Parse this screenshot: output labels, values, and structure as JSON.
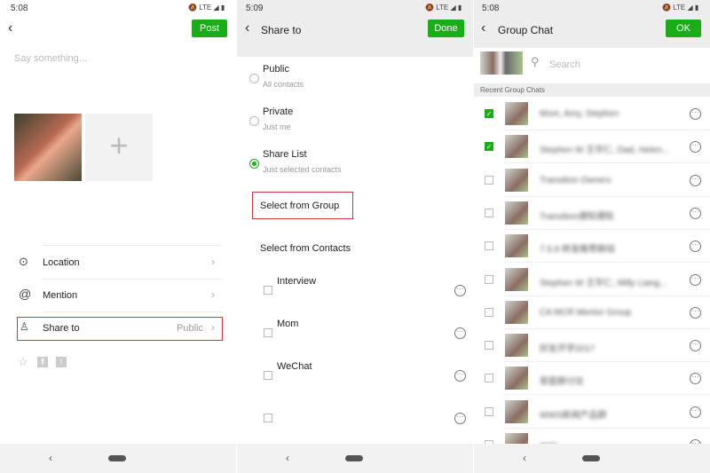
{
  "colors": {
    "accent": "#1aad19",
    "highlight": "#d0363e"
  },
  "panel1": {
    "time": "5:08",
    "network": "LTE",
    "post_label": "Post",
    "placeholder": "Say something...",
    "add_icon": "plus-icon",
    "menu": [
      {
        "icon": "location-icon",
        "label": "Location",
        "value": ""
      },
      {
        "icon": "at-icon",
        "label": "Mention",
        "value": ""
      },
      {
        "icon": "person-icon",
        "label": "Share to",
        "value": "Public"
      }
    ],
    "share_icons": [
      "star-icon",
      "facebook-icon",
      "twitter-icon"
    ]
  },
  "panel2": {
    "time": "5:09",
    "network": "LTE",
    "title": "Share to",
    "done_label": "Done",
    "options": [
      {
        "label": "Public",
        "sub": "All contacts",
        "selected": false
      },
      {
        "label": "Private",
        "sub": "Just me",
        "selected": false
      },
      {
        "label": "Share List",
        "sub": "Just selected contacts",
        "selected": true
      }
    ],
    "select_group": "Select from Group",
    "select_contacts": "Select from Contacts",
    "contacts": [
      "Interview",
      "Mom",
      "WeChat",
      ""
    ]
  },
  "panel3": {
    "time": "5:08",
    "network": "LTE",
    "title": "Group Chat",
    "ok_label": "OK",
    "search_placeholder": "Search",
    "section": "Recent Group Chats",
    "groups": [
      {
        "name": "Mom, Amy, Stephen",
        "checked": true
      },
      {
        "name": "Stephen W 王华仁, Dad, Helen...",
        "checked": true
      },
      {
        "name": "Transition Owners",
        "checked": false
      },
      {
        "name": "Transition通知通知",
        "checked": false
      },
      {
        "name": "7.5.9 转发推荐群组",
        "checked": false
      },
      {
        "name": "Stephen W 王华仁, Milly Liang...",
        "checked": false
      },
      {
        "name": "CA MCR Mentor Group",
        "checked": false
      },
      {
        "name": "好友开学2017",
        "checked": false
      },
      {
        "name": "家庭群讨论",
        "checked": false
      },
      {
        "name": "WWS新闻产品群",
        "checked": false
      },
      {
        "name": "群聊",
        "checked": false
      }
    ]
  }
}
